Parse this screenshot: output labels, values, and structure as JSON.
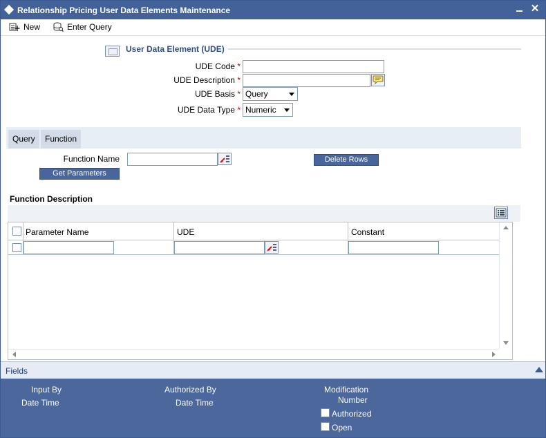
{
  "window": {
    "title": "Relationship Pricing User Data Elements Maintenance"
  },
  "toolbar": {
    "new_label": "New",
    "enter_query_label": "Enter Query"
  },
  "section": {
    "title": "User Data Element (UDE)"
  },
  "form": {
    "ude_code_label": "UDE Code",
    "ude_code_value": "",
    "ude_description_label": "UDE Description",
    "ude_description_value": "",
    "ude_basis_label": "UDE Basis",
    "ude_basis_value": "Query",
    "ude_data_type_label": "UDE Data Type",
    "ude_data_type_value": "Numeric",
    "required_marker": "*"
  },
  "tabs": [
    {
      "label": "Query"
    },
    {
      "label": "Function"
    }
  ],
  "function_tab": {
    "function_name_label": "Function Name",
    "function_name_value": "",
    "delete_rows_label": "Delete Rows",
    "get_parameters_label": "Get Parameters"
  },
  "function_description": {
    "title": "Function Description",
    "columns": [
      "Parameter Name",
      "UDE",
      "Constant"
    ],
    "rows": [
      {
        "parameter_name": "",
        "ude": "",
        "constant": ""
      }
    ]
  },
  "fields_bar": {
    "label": "Fields"
  },
  "footer": {
    "input_by_label": "Input By",
    "input_date_time_label": "Date Time",
    "authorized_by_label": "Authorized By",
    "authorized_date_time_label": "Date Time",
    "modification_label": "Modification",
    "number_label": "Number",
    "authorized_label": "Authorized",
    "open_label": "Open"
  },
  "colors": {
    "title_bar": "#44629a",
    "footer": "#4b679b",
    "section_title": "#2f4e88",
    "required": "#c00000"
  }
}
